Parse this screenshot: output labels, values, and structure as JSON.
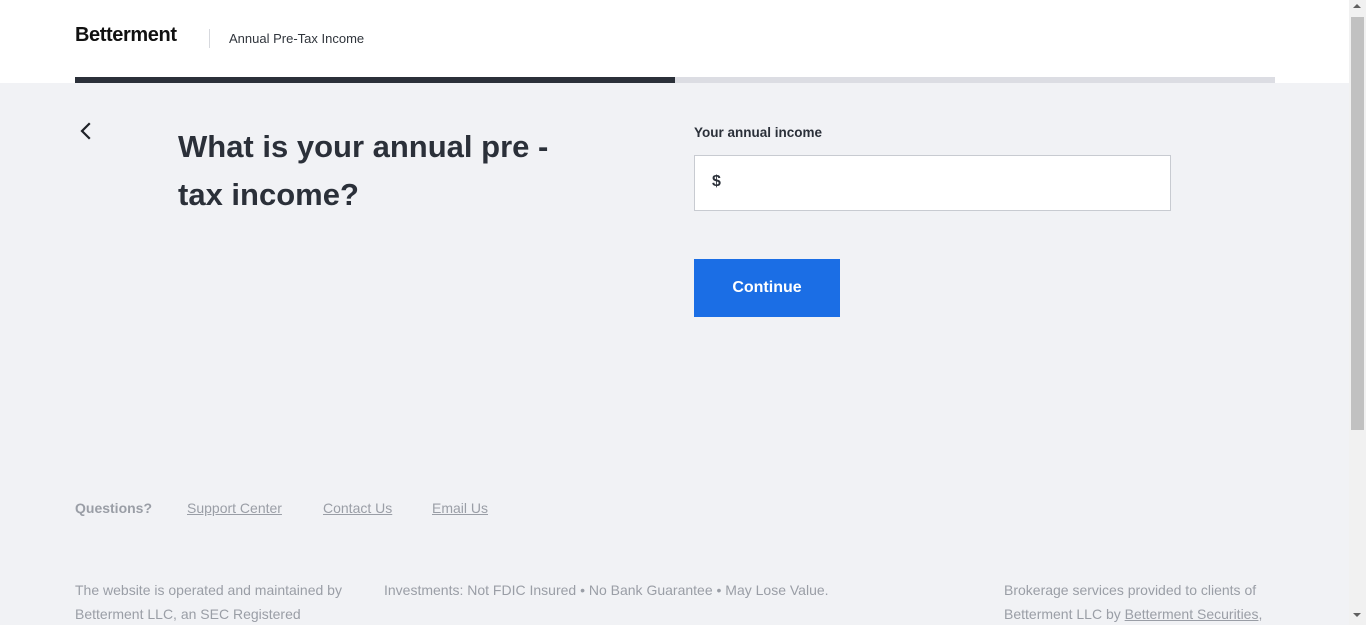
{
  "header": {
    "logo": "Betterment",
    "subtitle": "Annual Pre-Tax Income"
  },
  "progress": {
    "fraction": 0.5
  },
  "main": {
    "back_icon": "chevron-left-icon",
    "question": "What is your annual pre -tax income?",
    "field_label": "Your annual income",
    "currency_symbol": "$",
    "income_value": "",
    "continue_label": "Continue"
  },
  "footer": {
    "questions_label": "Questions?",
    "links": [
      "Support Center",
      "Contact Us",
      "Email Us"
    ],
    "col1": "The website is operated and maintained by Betterment LLC, an SEC Registered",
    "col2": "Investments: Not FDIC Insured • No Bank Guarantee • May Lose Value.",
    "col3_text": "Brokerage services provided to clients of Betterment LLC by",
    "col3_link": "Betterment Securities",
    "col3_tail": ","
  },
  "colors": {
    "accent": "#1b6ee5",
    "text_dark": "#2b3039",
    "background": "#f1f2f5",
    "muted": "#9a9ea6"
  }
}
